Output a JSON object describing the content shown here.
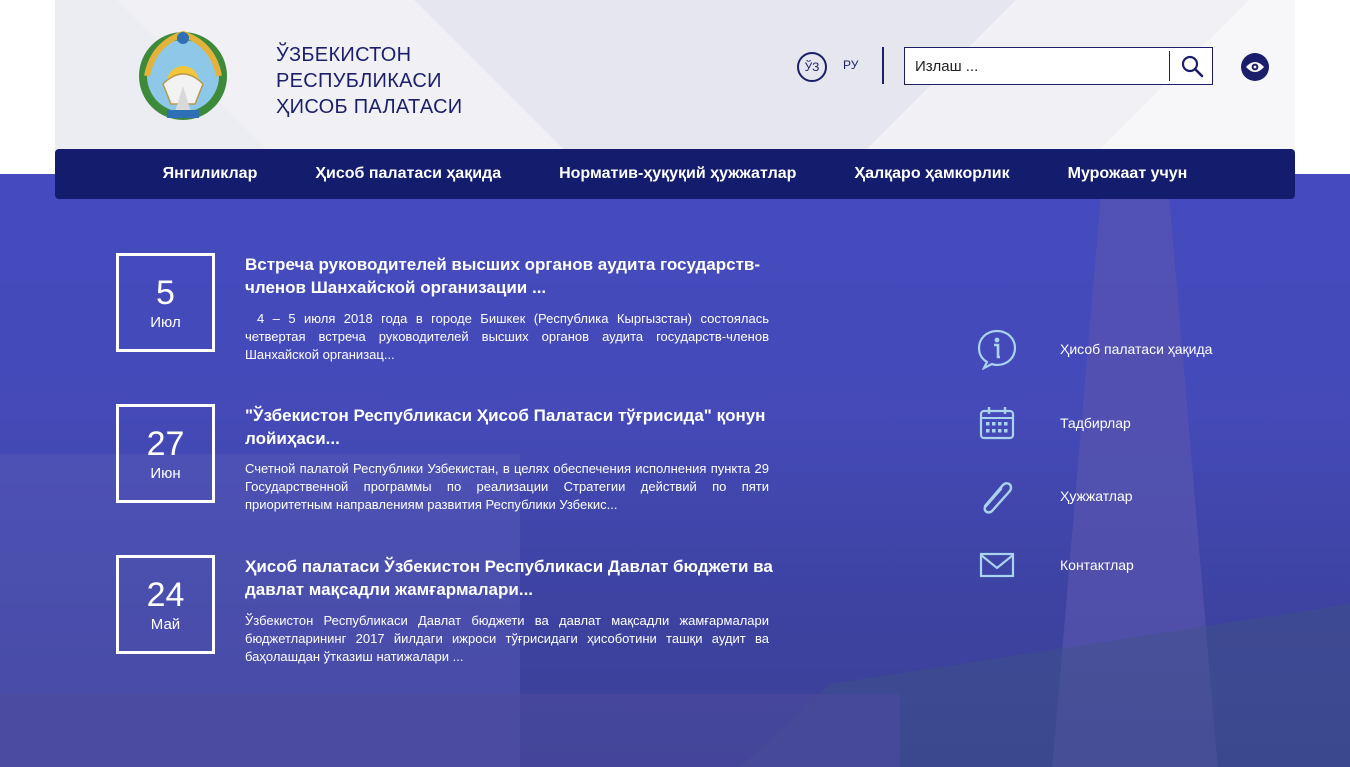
{
  "header": {
    "title_lines": [
      "ЎЗБЕКИСТОН",
      "РЕСПУБЛИКАСИ",
      "ҲИСОБ ПАЛАТАСИ"
    ],
    "lang_uz": "ЎЗ",
    "lang_ru": "РУ",
    "search_placeholder": "Излаш ..."
  },
  "nav": {
    "items": [
      "Янгиликлар",
      "Ҳисоб палатаси ҳақида",
      "Норматив-ҳуқуқий ҳужжатлар",
      "Ҳалқаро ҳамкорлик",
      "Мурожаат учун"
    ]
  },
  "news": [
    {
      "day": "5",
      "month": "Июл",
      "title": "Встреча руководителей высших органов аудита государств-членов Шанхайской организации ...",
      "text": "4 – 5 июля 2018 года в городе Бишкек (Республика Кыргызстан) состоялась четвертая встреча руководителей высших органов аудита государств-членов Шанхайской организац..."
    },
    {
      "day": "27",
      "month": "Июн",
      "title": "\"Ўзбекистон Республикаси Ҳисоб Палатаси тўғрисида\" қонун лойиҳаси...",
      "text": "Счетной палатой Республики Узбекистан, в целях обеспечения исполнения пункта 29 Государственной программы по реализации Стратегии действий по пяти приоритетным направлениям развития Республики Узбекис..."
    },
    {
      "day": "24",
      "month": "Май",
      "title": "Ҳисоб палатаси Ўзбекистон Республикаси Давлат бюджети ва давлат мақсадли жамғармалари...",
      "text": "Ўзбекистон Республикаси Давлат бюджети ва давлат мақсадли жамғармалари бюджетларининг 2017 йилдаги ижроси тўғрисидаги ҳисоботини ташқи аудит ва баҳолашдан ўтказиш натижалари ..."
    }
  ],
  "quick_links": [
    {
      "label": "Ҳисоб палатаси ҳақида",
      "icon": "info-icon"
    },
    {
      "label": "Тадбирлар",
      "icon": "calendar-icon"
    },
    {
      "label": "Ҳужжатлар",
      "icon": "paperclip-icon"
    },
    {
      "label": "Контактлар",
      "icon": "envelope-icon"
    }
  ],
  "colors": {
    "brand": "#1b1f6b",
    "nav_bg": "#141c6e",
    "hero_overlay": "#4a4fc0"
  }
}
